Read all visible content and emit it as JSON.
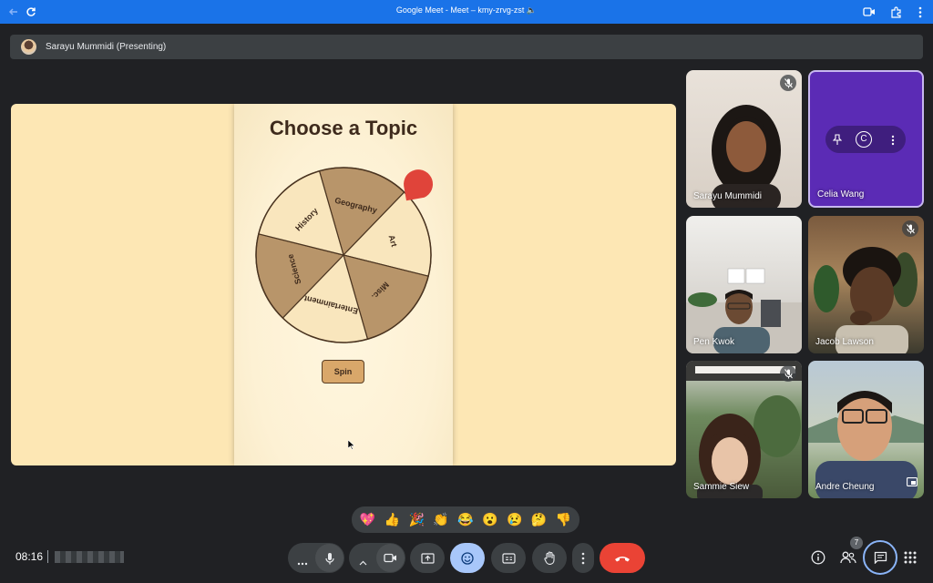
{
  "titlebar": {
    "title": "Google Meet - Meet – kmy-zrvg-zst 🔈"
  },
  "presenter": {
    "label": "Sarayu Mummidi (Presenting)"
  },
  "presentation": {
    "heading": "Choose a Topic",
    "wheel_segments": [
      "Geography",
      "Art",
      "Misc.",
      "Entertainment",
      "Science",
      "History"
    ],
    "spin_label": "Spin"
  },
  "participants": [
    {
      "name": "Sarayu Mummidi",
      "muted": true
    },
    {
      "name": "Celia Wang",
      "muted": false,
      "avatar_letter": "C"
    },
    {
      "name": "Pen Kwok",
      "muted": false
    },
    {
      "name": "Jacob Lawson",
      "muted": true
    },
    {
      "name": "Sammie Siew",
      "muted": true
    },
    {
      "name": "Andre Cheung",
      "muted": false
    }
  ],
  "reactions": [
    "💖",
    "👍",
    "🎉",
    "👏",
    "😂",
    "😮",
    "😢",
    "🤔",
    "👎"
  ],
  "bottom": {
    "time": "08:16",
    "people_count": "7"
  },
  "colors": {
    "accent_blue": "#1a73e8",
    "end_call": "#ea4335",
    "active_button": "#a8c7fa",
    "wheel_dark": "#b8956a",
    "wheel_light": "#f9e6bd"
  }
}
